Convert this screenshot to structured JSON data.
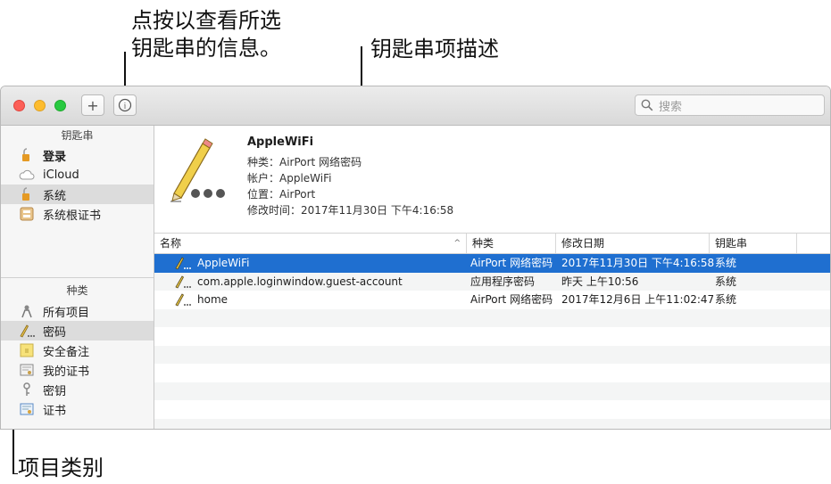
{
  "callouts": {
    "info_button": {
      "line1": "点按以查看所选",
      "line2": "钥匙串的信息。"
    },
    "item_description": "钥匙串项描述",
    "item_category": "项目类别"
  },
  "toolbar": {
    "add_label": "+",
    "info_label": "i",
    "search_placeholder": "搜索"
  },
  "sidebar": {
    "keychains_header": "钥匙串",
    "keychains": [
      {
        "label": "登录",
        "icon": "lock-open-icon"
      },
      {
        "label": "iCloud",
        "icon": "cloud-icon"
      },
      {
        "label": "系统",
        "icon": "lock-open-icon"
      },
      {
        "label": "系统根证书",
        "icon": "certificate-cabinet-icon"
      }
    ],
    "category_header": "种类",
    "categories": [
      {
        "label": "所有项目",
        "icon": "people-icon"
      },
      {
        "label": "密码",
        "icon": "pen-icon"
      },
      {
        "label": "安全备注",
        "icon": "note-icon"
      },
      {
        "label": "我的证书",
        "icon": "certificate-icon"
      },
      {
        "label": "密钥",
        "icon": "key-icon"
      },
      {
        "label": "证书",
        "icon": "certificate-icon"
      }
    ]
  },
  "info": {
    "title": "AppleWiFi",
    "kind": "种类：AirPort 网络密码",
    "account": "帐户：AppleWiFi",
    "where": "位置：AirPort",
    "modified": "修改时间：2017年11月30日 下午4:16:58"
  },
  "table": {
    "columns": {
      "name": "名称",
      "kind": "种类",
      "date": "修改日期",
      "keychain": "钥匙串"
    },
    "sort_indicator": "^",
    "rows": [
      {
        "name": "AppleWiFi",
        "kind": "AirPort 网络密码",
        "date": "2017年11月30日 下午4:16:58",
        "keychain": "系统"
      },
      {
        "name": "com.apple.loginwindow.guest-account",
        "kind": "应用程序密码",
        "date": "昨天 上午10:56",
        "keychain": "系统"
      },
      {
        "name": "home",
        "kind": "AirPort 网络密码",
        "date": "2017年12月6日 上午11:02:47",
        "keychain": "系统"
      }
    ]
  },
  "colors": {
    "selection": "#1f6fd0",
    "alt_row": "#f4f5f5"
  }
}
